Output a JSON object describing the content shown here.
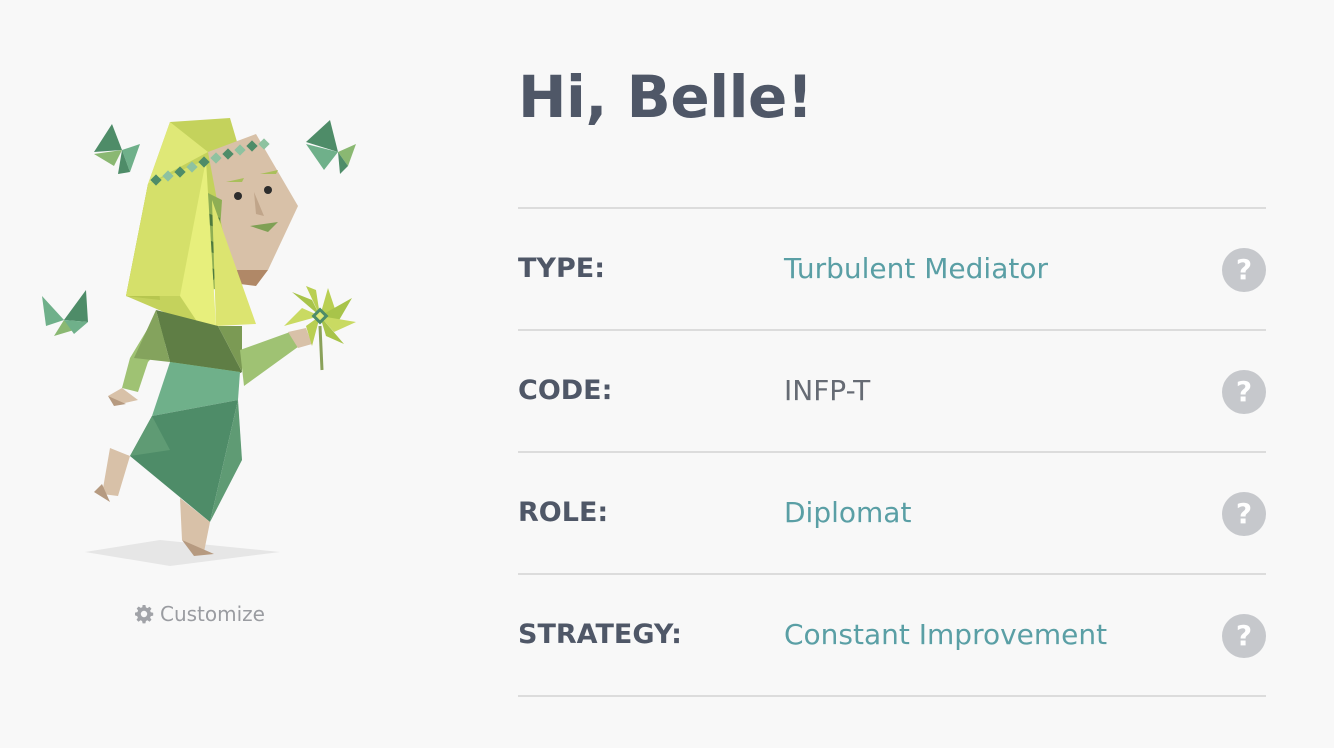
{
  "profile": {
    "greeting": "Hi, Belle!",
    "customize_label": "Customize",
    "customize_icon": "gear-icon"
  },
  "traits": [
    {
      "label": "TYPE:",
      "value": "Turbulent Mediator",
      "value_style": "link",
      "help": "?"
    },
    {
      "label": "CODE:",
      "value": "INFP-T",
      "value_style": "plain",
      "help": "?"
    },
    {
      "label": "ROLE:",
      "value": "Diplomat",
      "value_style": "link",
      "help": "?"
    },
    {
      "label": "STRATEGY:",
      "value": "Constant Improvement",
      "value_style": "link",
      "help": "?"
    }
  ],
  "colors": {
    "background": "#f8f8f8",
    "heading": "#4f5767",
    "link_value": "#5a9fa5",
    "plain_value": "#666b74",
    "help_button": "#c6c8cc",
    "divider": "#dcdcdc"
  }
}
